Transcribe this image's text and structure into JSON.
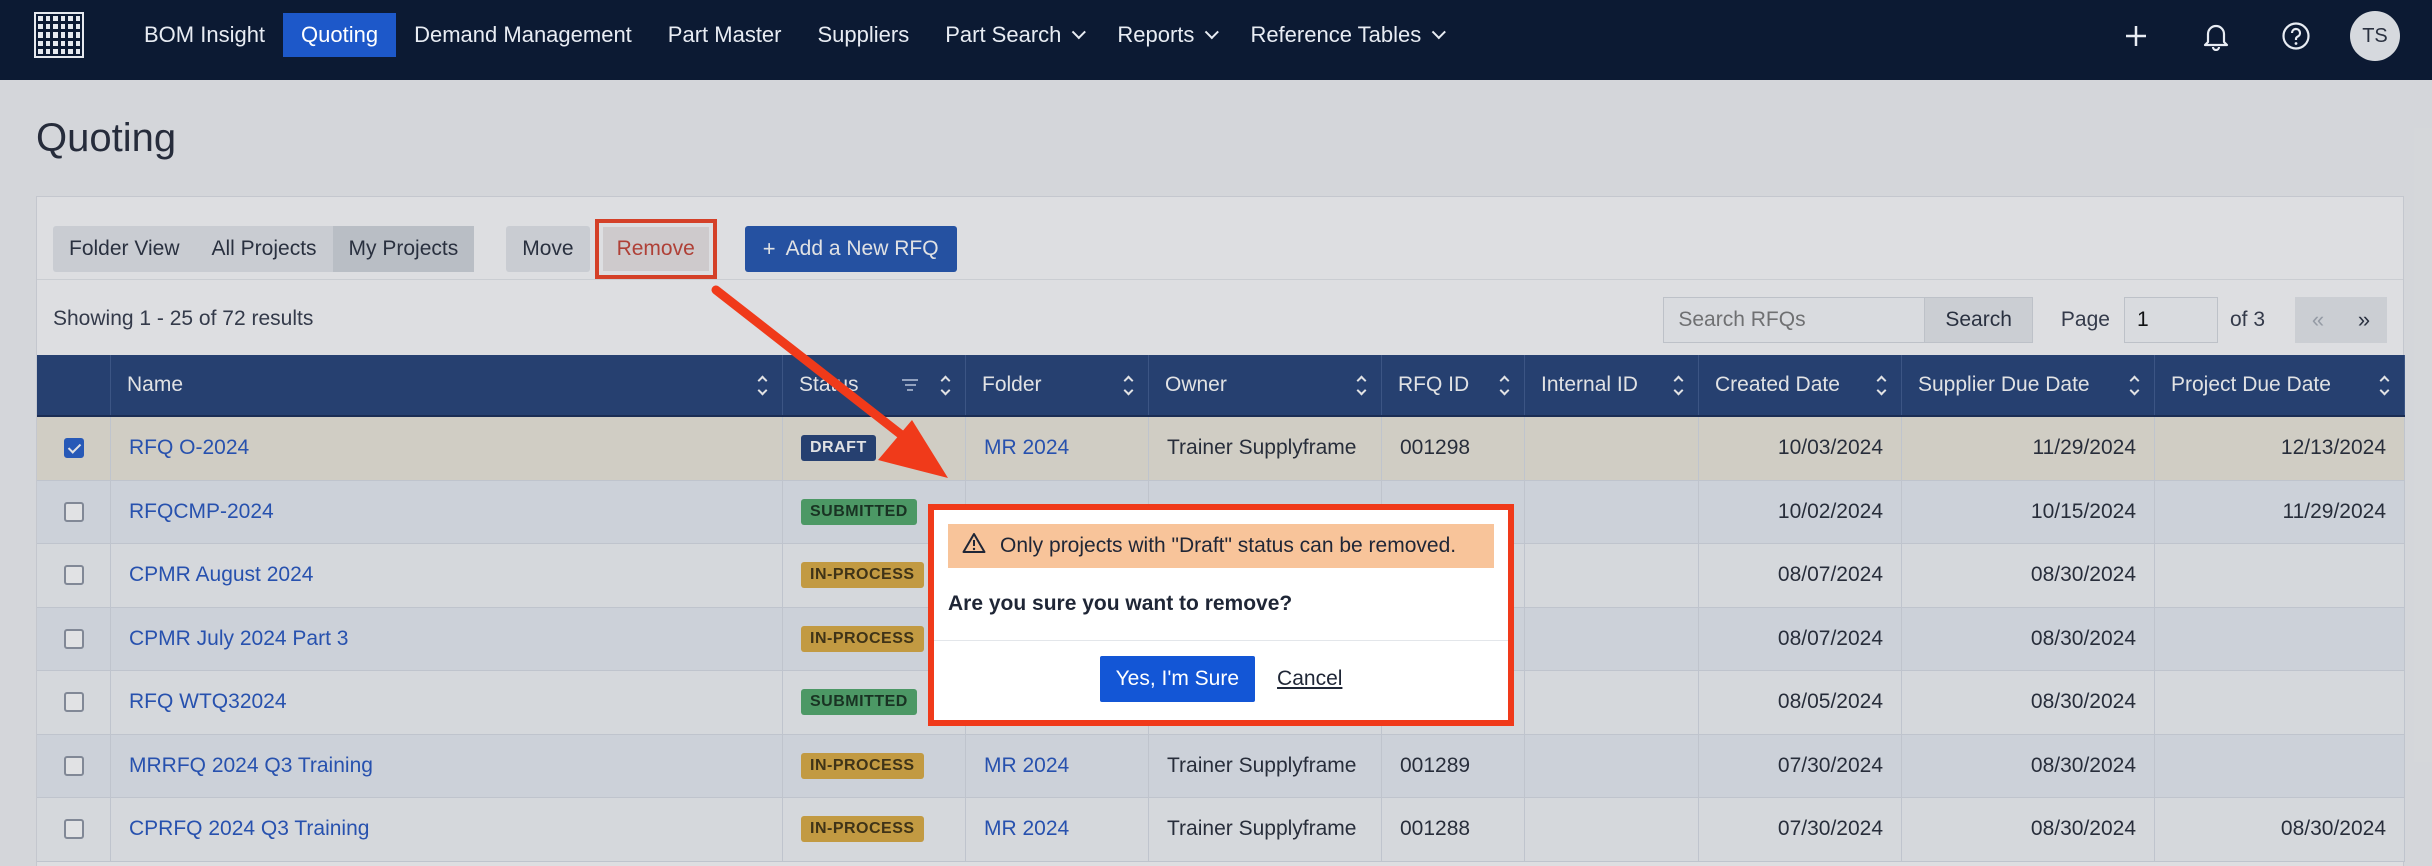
{
  "nav": {
    "items": [
      {
        "label": "BOM Insight",
        "active": false,
        "dropdown": false
      },
      {
        "label": "Quoting",
        "active": true,
        "dropdown": false
      },
      {
        "label": "Demand Management",
        "active": false,
        "dropdown": false
      },
      {
        "label": "Part Master",
        "active": false,
        "dropdown": false
      },
      {
        "label": "Suppliers",
        "active": false,
        "dropdown": false
      },
      {
        "label": "Part Search",
        "active": false,
        "dropdown": true
      },
      {
        "label": "Reports",
        "active": false,
        "dropdown": true
      },
      {
        "label": "Reference Tables",
        "active": false,
        "dropdown": true
      }
    ],
    "avatar_initials": "TS"
  },
  "page": {
    "title": "Quoting"
  },
  "toolbar": {
    "views": [
      {
        "label": "Folder View",
        "selected": false
      },
      {
        "label": "All Projects",
        "selected": false
      },
      {
        "label": "My Projects",
        "selected": true
      }
    ],
    "move_label": "Move",
    "remove_label": "Remove",
    "add_label": "Add a New RFQ"
  },
  "results": {
    "showing": "Showing 1 - 25 of 72 results"
  },
  "search": {
    "placeholder": "Search RFQs",
    "button_label": "Search"
  },
  "pager": {
    "page_label": "Page",
    "page_value": "1",
    "of_label": "of 3",
    "prev": "«",
    "next": "»"
  },
  "table": {
    "columns": [
      "",
      "Name",
      "Status",
      "Folder",
      "Owner",
      "RFQ ID",
      "Internal ID",
      "Created Date",
      "Supplier Due Date",
      "Project Due Date"
    ],
    "rows": [
      {
        "checked": true,
        "name": "RFQ O-2024",
        "status": "DRAFT",
        "folder": "MR 2024",
        "owner": "Trainer Supplyframe",
        "rfq_id": "001298",
        "internal_id": "",
        "created": "10/03/2024",
        "supplier_due": "11/29/2024",
        "project_due": "12/13/2024"
      },
      {
        "checked": false,
        "name": "RFQCMP-2024",
        "status": "SUBMITTED",
        "folder": "",
        "owner": "",
        "rfq_id": "",
        "internal_id": "",
        "created": "10/02/2024",
        "supplier_due": "10/15/2024",
        "project_due": "11/29/2024"
      },
      {
        "checked": false,
        "name": "CPMR August 2024",
        "status": "IN-PROCESS",
        "folder": "",
        "owner": "",
        "rfq_id": "",
        "internal_id": "",
        "created": "08/07/2024",
        "supplier_due": "08/30/2024",
        "project_due": ""
      },
      {
        "checked": false,
        "name": "CPMR July 2024 Part 3",
        "status": "IN-PROCESS",
        "folder": "",
        "owner": "",
        "rfq_id": "",
        "internal_id": "",
        "created": "08/07/2024",
        "supplier_due": "08/30/2024",
        "project_due": ""
      },
      {
        "checked": false,
        "name": "RFQ WTQ32024",
        "status": "SUBMITTED",
        "folder": "",
        "owner": "",
        "rfq_id": "",
        "internal_id": "",
        "created": "08/05/2024",
        "supplier_due": "08/30/2024",
        "project_due": ""
      },
      {
        "checked": false,
        "name": "MRRFQ 2024 Q3 Training",
        "status": "IN-PROCESS",
        "folder": "MR 2024",
        "owner": "Trainer Supplyframe",
        "rfq_id": "001289",
        "internal_id": "",
        "created": "07/30/2024",
        "supplier_due": "08/30/2024",
        "project_due": ""
      },
      {
        "checked": false,
        "name": "CPRFQ 2024 Q3 Training",
        "status": "IN-PROCESS",
        "folder": "MR 2024",
        "owner": "Trainer Supplyframe",
        "rfq_id": "001288",
        "internal_id": "",
        "created": "07/30/2024",
        "supplier_due": "08/30/2024",
        "project_due": "08/30/2024"
      }
    ]
  },
  "modal": {
    "warning": "Only projects with \"Draft\" status can be removed.",
    "question": "Are you sure you want to remove?",
    "confirm_label": "Yes, I'm Sure",
    "cancel_label": "Cancel"
  },
  "colors": {
    "nav_bg": "#0c1a33",
    "active": "#1d58c9",
    "highlight": "#f03a1a",
    "header_bg": "#1b3a72"
  }
}
